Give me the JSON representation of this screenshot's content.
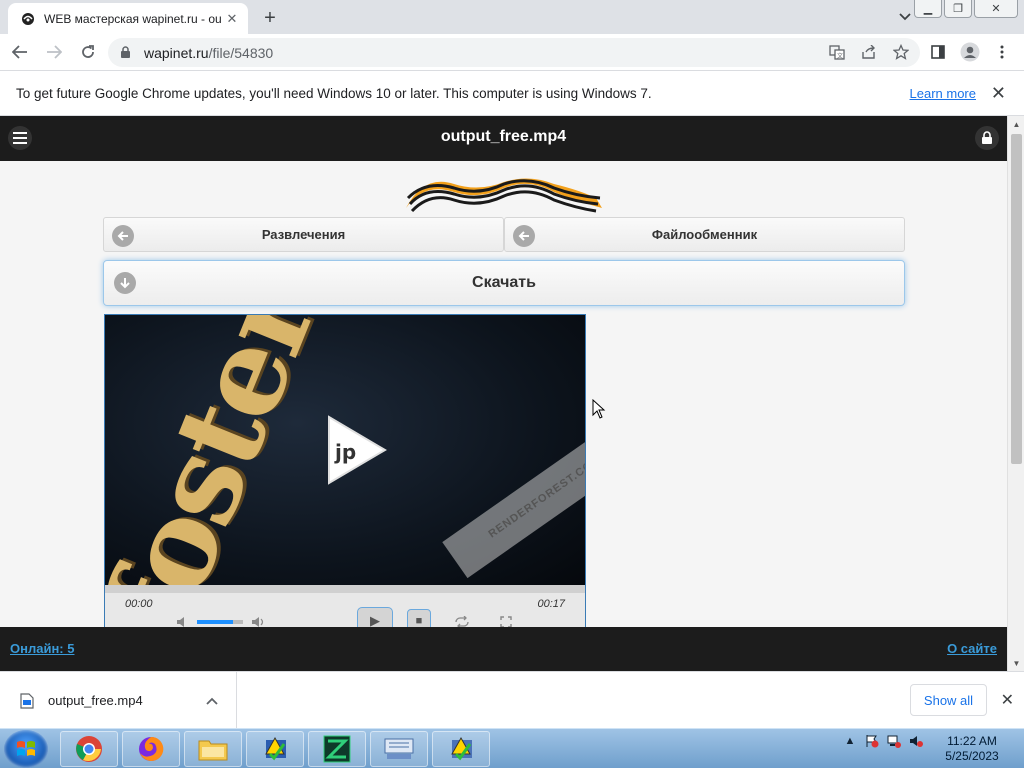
{
  "browser": {
    "tab": {
      "title": "WEB мастерская wapinet.ru - ou",
      "favicon": "web-workshop-favicon"
    },
    "new_tab_label": "+",
    "address": {
      "domain": "wapinet.ru",
      "path": "/file/54830"
    },
    "infobar": {
      "message": "To get future Google Chrome updates, you'll need Windows 10 or later. This computer is using Windows 7.",
      "learn_more": "Learn more"
    }
  },
  "site": {
    "title": "output_free.mp4",
    "nav": [
      {
        "label": "Развлечения"
      },
      {
        "label": "Файлообменник"
      }
    ],
    "download_label": "Скачать",
    "player": {
      "current_time": "00:00",
      "duration": "00:17",
      "watermark": "RENDERFOREST.COM",
      "video_text": "foster.D",
      "volume_fraction": 0.78
    },
    "footer": {
      "online": "Онлайн: 5",
      "about": "О сайте"
    }
  },
  "downloads": {
    "file": "output_free.mp4",
    "show_all": "Show all"
  },
  "taskbar": {
    "time": "11:22 AM",
    "date": "5/25/2023",
    "apps": [
      "chrome-icon",
      "firefox-icon",
      "explorer-icon",
      "app-warning-icon",
      "app-green-icon",
      "keyboard-icon",
      "app-warning-2-icon"
    ]
  },
  "colors": {
    "accent_blue": "#1a73e8",
    "site_dark": "#1c1c1c",
    "link_blue": "#3a9bd9"
  }
}
